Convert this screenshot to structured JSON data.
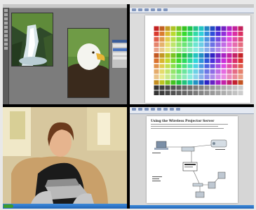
{
  "panes": {
    "top_left": {
      "app": "photo-editor",
      "titlebar": ""
    },
    "top_right": {
      "app": "color-chart-document",
      "titlebar": "",
      "sheet_title": ""
    },
    "bottom_left": {
      "app": "video-conference"
    },
    "bottom_right": {
      "app": "presentation-document",
      "heading": "Using the Wireless Projector Server"
    }
  },
  "colors": {
    "divider": "#000000",
    "ribbon": "#e4e9f2",
    "taskbar": "#2a6fc4",
    "start_button": "#3c9b2d",
    "photo_editor_bg": "#7c7c7c"
  },
  "icons": [
    "toolbox-icon",
    "layers-palette-icon",
    "projector-icon",
    "laptop-icon",
    "network-hub-icon",
    "start-button-icon"
  ]
}
